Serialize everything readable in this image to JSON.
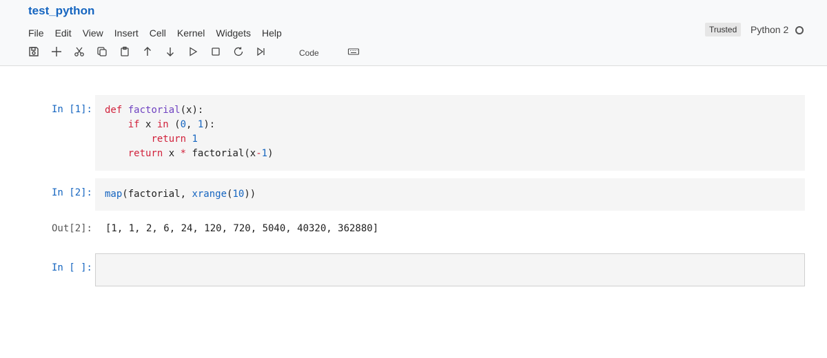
{
  "notebook": {
    "title": "test_python"
  },
  "menubar": [
    "File",
    "Edit",
    "View",
    "Insert",
    "Cell",
    "Kernel",
    "Widgets",
    "Help"
  ],
  "status": {
    "trusted": "Trusted",
    "kernel": "Python 2"
  },
  "toolbar": {
    "buttons": [
      "save-icon",
      "plus-icon",
      "cut-icon",
      "copy-icon",
      "paste-icon",
      "arrow-up-icon",
      "arrow-down-icon",
      "run-icon",
      "stop-icon",
      "restart-icon",
      "fast-forward-icon",
      "keyboard-icon"
    ],
    "cell_type": "Code"
  },
  "cells": {
    "c1": {
      "prompt": "In [1]:",
      "lines": [
        [
          "",
          "def",
          " ",
          "factorial",
          "(x):",
          "",
          "",
          "",
          "",
          "",
          ""
        ],
        [
          "    ",
          "if",
          " x ",
          "in",
          " (",
          "0",
          ", ",
          "1",
          "):",
          "",
          ""
        ],
        [
          "        ",
          "return",
          " ",
          "1",
          "",
          "",
          "",
          "",
          "",
          "",
          ""
        ],
        [
          "    ",
          "return",
          " x ",
          "*",
          " factorial(x",
          "-",
          "",
          "1",
          ")",
          "",
          ""
        ]
      ],
      "text": {
        "l1_def": "def",
        "l1_fn": "factorial",
        "l1_rest": "(x):",
        "l2_indent": "    ",
        "l2_if": "if",
        "l2_x": " x ",
        "l2_in": "in",
        "l2_open": " (",
        "l2_n0": "0",
        "l2_comma": ", ",
        "l2_n1": "1",
        "l2_close": "):",
        "l3_indent": "        ",
        "l3_return": "return",
        "l3_sp": " ",
        "l3_n1": "1",
        "l4_indent": "    ",
        "l4_return": "return",
        "l4_x": " x ",
        "l4_star": "*",
        "l4_call": " factorial(x",
        "l4_minus": "-",
        "l4_n1": "1",
        "l4_close": ")"
      }
    },
    "c2": {
      "prompt": "In [2]:",
      "text": {
        "map": "map(factorial, ",
        "xrange": "xrange",
        "open": "(",
        "n10": "10",
        "close": "))"
      },
      "out_prompt": "Out[2]:",
      "output": "[1, 1, 2, 6, 24, 120, 720, 5040, 40320, 362880]"
    },
    "c3": {
      "prompt": "In [ ]:"
    }
  }
}
